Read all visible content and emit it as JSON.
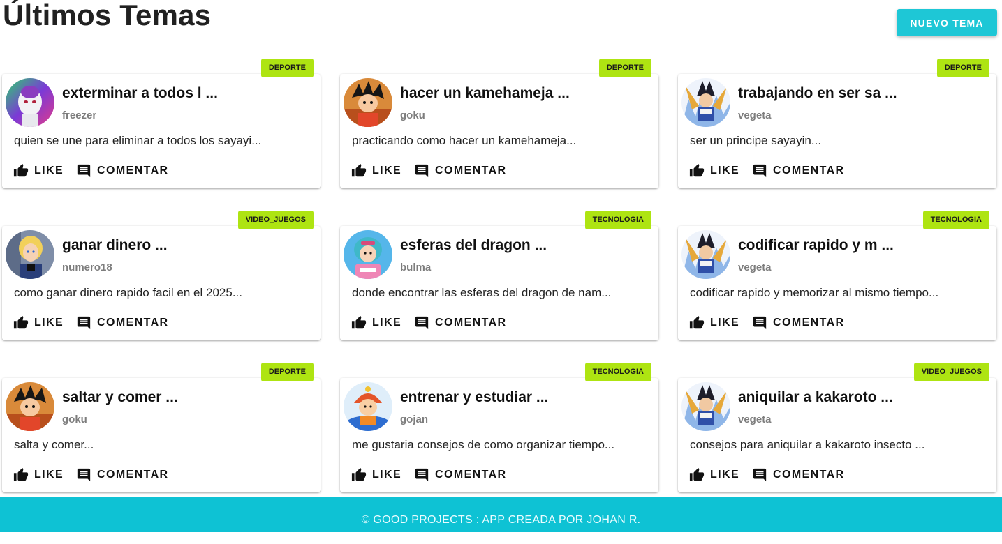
{
  "header": {
    "title": "Últimos Temas",
    "new_button": "NUEVO TEMA"
  },
  "actions": {
    "like": "LIKE",
    "comment": "COMENTAR"
  },
  "topics": [
    {
      "title": "exterminar a todos l ...",
      "author": "freezer",
      "description": "quien se une para eliminar a todos los sayayi...",
      "category": "DEPORTE",
      "avatar": "freezer"
    },
    {
      "title": "hacer un kamehameja ...",
      "author": "goku",
      "description": "practicando como hacer un kamehameja...",
      "category": "DEPORTE",
      "avatar": "goku"
    },
    {
      "title": "trabajando en ser sa ...",
      "author": "vegeta",
      "description": "ser un principe sayayin...",
      "category": "DEPORTE",
      "avatar": "vegeta"
    },
    {
      "title": "ganar dinero ...",
      "author": "numero18",
      "description": "como ganar dinero rapido facil en el 2025...",
      "category": "VIDEO_JUEGOS",
      "avatar": "numero18"
    },
    {
      "title": "esferas del dragon ...",
      "author": "bulma",
      "description": "donde encontrar las esferas del dragon de nam...",
      "category": "TECNOLOGIA",
      "avatar": "bulma"
    },
    {
      "title": "codificar rapido y m ...",
      "author": "vegeta",
      "description": "codificar rapido y memorizar al mismo tiempo...",
      "category": "TECNOLOGIA",
      "avatar": "vegeta"
    },
    {
      "title": "saltar y comer ...",
      "author": "goku",
      "description": "salta y comer...",
      "category": "DEPORTE",
      "avatar": "goku"
    },
    {
      "title": "entrenar y estudiar ...",
      "author": "gojan",
      "description": "me gustaria consejos de como organizar tiempo...",
      "category": "TECNOLOGIA",
      "avatar": "gojan"
    },
    {
      "title": "aniquilar a kakaroto ...",
      "author": "vegeta",
      "description": "consejos para aniquilar a kakaroto insecto ...",
      "category": "VIDEO_JUEGOS",
      "avatar": "vegeta"
    }
  ],
  "footer": {
    "text": "© GOOD PROJECTS : APP CREADA POR JOHAN R."
  },
  "colors": {
    "accent": "#1ec7d6",
    "footer": "#0ec2d4",
    "badge": "#aee412",
    "author": "#7d7d7d"
  }
}
